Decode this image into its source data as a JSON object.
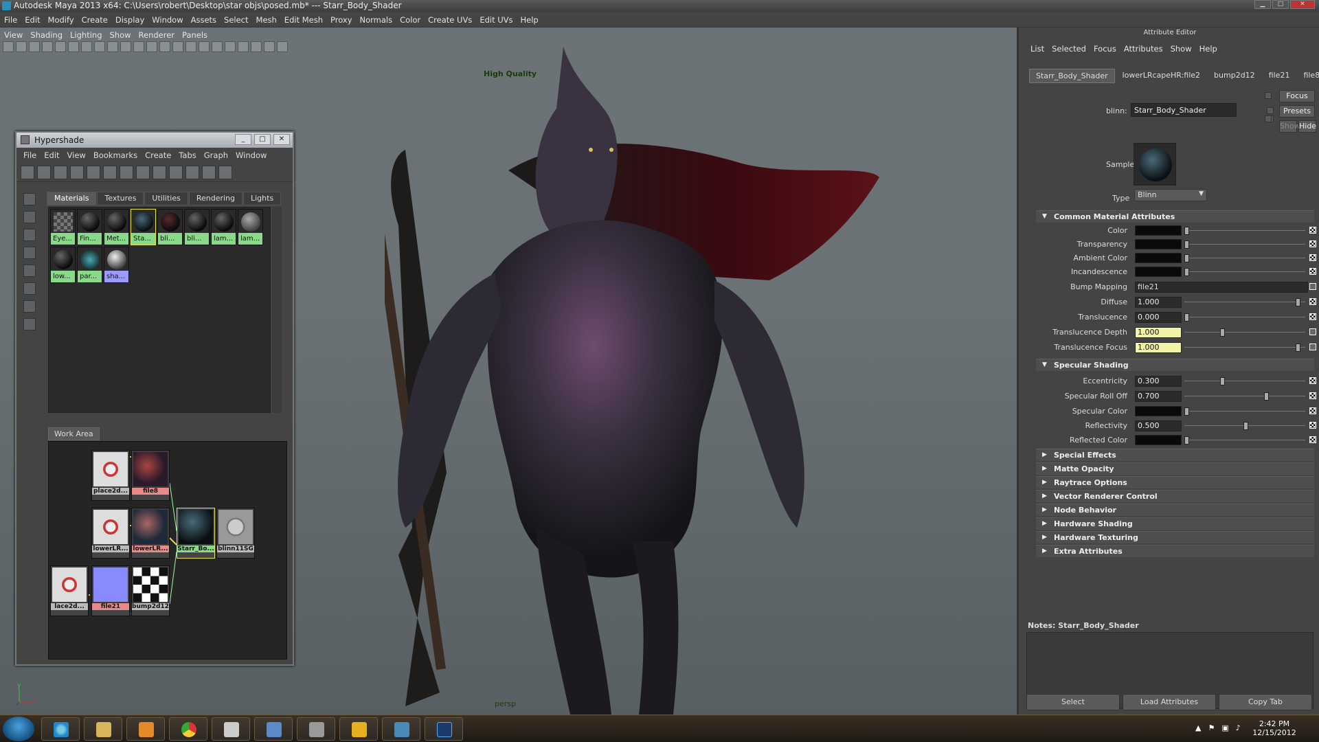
{
  "window": {
    "title": "Autodesk Maya 2013 x64: C:\\Users\\robert\\Desktop\\star  objs\\posed.mb*   ---   Starr_Body_Shader"
  },
  "menubar": [
    "File",
    "Edit",
    "Modify",
    "Create",
    "Display",
    "Window",
    "Assets",
    "Select",
    "Mesh",
    "Edit Mesh",
    "Proxy",
    "Normals",
    "Color",
    "Create UVs",
    "Edit UVs",
    "Help"
  ],
  "viewport": {
    "menu": [
      "View",
      "Shading",
      "Lighting",
      "Show",
      "Renderer",
      "Panels"
    ],
    "hud_quality": "High Quality",
    "camera": "persp",
    "axis_y": "y",
    "axis_x": "x"
  },
  "hypershade": {
    "title": "Hypershade",
    "menu": [
      "File",
      "Edit",
      "View",
      "Bookmarks",
      "Create",
      "Tabs",
      "Graph",
      "Window"
    ],
    "tabs": [
      "Materials",
      "Textures",
      "Utilities",
      "Rendering",
      "Lights"
    ],
    "swatches": [
      "Eye...",
      "Fin...",
      "Met...",
      "Sta...",
      "bli...",
      "bli...",
      "lam...",
      "lam...",
      "low...",
      "par...",
      "sha..."
    ],
    "workarea_tab": "Work Area",
    "nodes": [
      "place2d...",
      "file8",
      "lowerLR...",
      "lowerLR...",
      "Starr_Bo...",
      "blinn11SG",
      "lace2d...",
      "file21",
      "bump2d12"
    ]
  },
  "attribute_editor": {
    "title": "Attribute Editor",
    "menu": [
      "List",
      "Selected",
      "Focus",
      "Attributes",
      "Show",
      "Help"
    ],
    "tabs": [
      "Starr_Body_Shader",
      "lowerLRcapeHR:file2",
      "bump2d12",
      "file21",
      "file8"
    ],
    "focus_btn": "Focus",
    "presets_btn": "Presets",
    "show_btn": "Show",
    "hide_btn": "Hide",
    "blinn_label": "blinn:",
    "blinn_value": "Starr_Body_Shader",
    "sample_label": "Sample",
    "type_label": "Type",
    "type_value": "Blinn",
    "common_section": "Common Material Attributes",
    "common": {
      "color": "Color",
      "transparency": "Transparency",
      "ambient": "Ambient Color",
      "incandescence": "Incandescence",
      "bump_label": "Bump Mapping",
      "bump_value": "file21",
      "diffuse_label": "Diffuse",
      "diffuse_value": "1.000",
      "transl_label": "Translucence",
      "transl_value": "0.000",
      "transl_depth_label": "Translucence Depth",
      "transl_depth_value": "1.000",
      "transl_focus_label": "Translucence Focus",
      "transl_focus_value": "1.000"
    },
    "spec_section": "Specular Shading",
    "spec": {
      "ecc_label": "Eccentricity",
      "ecc_value": "0.300",
      "roll_label": "Specular Roll Off",
      "roll_value": "0.700",
      "speccolor_label": "Specular Color",
      "refl_label": "Reflectivity",
      "refl_value": "0.500",
      "reflcolor_label": "Reflected Color"
    },
    "collapsed_sections": [
      "Special Effects",
      "Matte Opacity",
      "Raytrace Options",
      "Vector Renderer Control",
      "Node Behavior",
      "Hardware Shading",
      "Hardware Texturing",
      "Extra Attributes"
    ],
    "notes": "Notes:  Starr_Body_Shader",
    "bottom_buttons": [
      "Select",
      "Load Attributes",
      "Copy Tab"
    ]
  },
  "taskbar": {
    "time": "2:42 PM",
    "date": "12/15/2012"
  }
}
